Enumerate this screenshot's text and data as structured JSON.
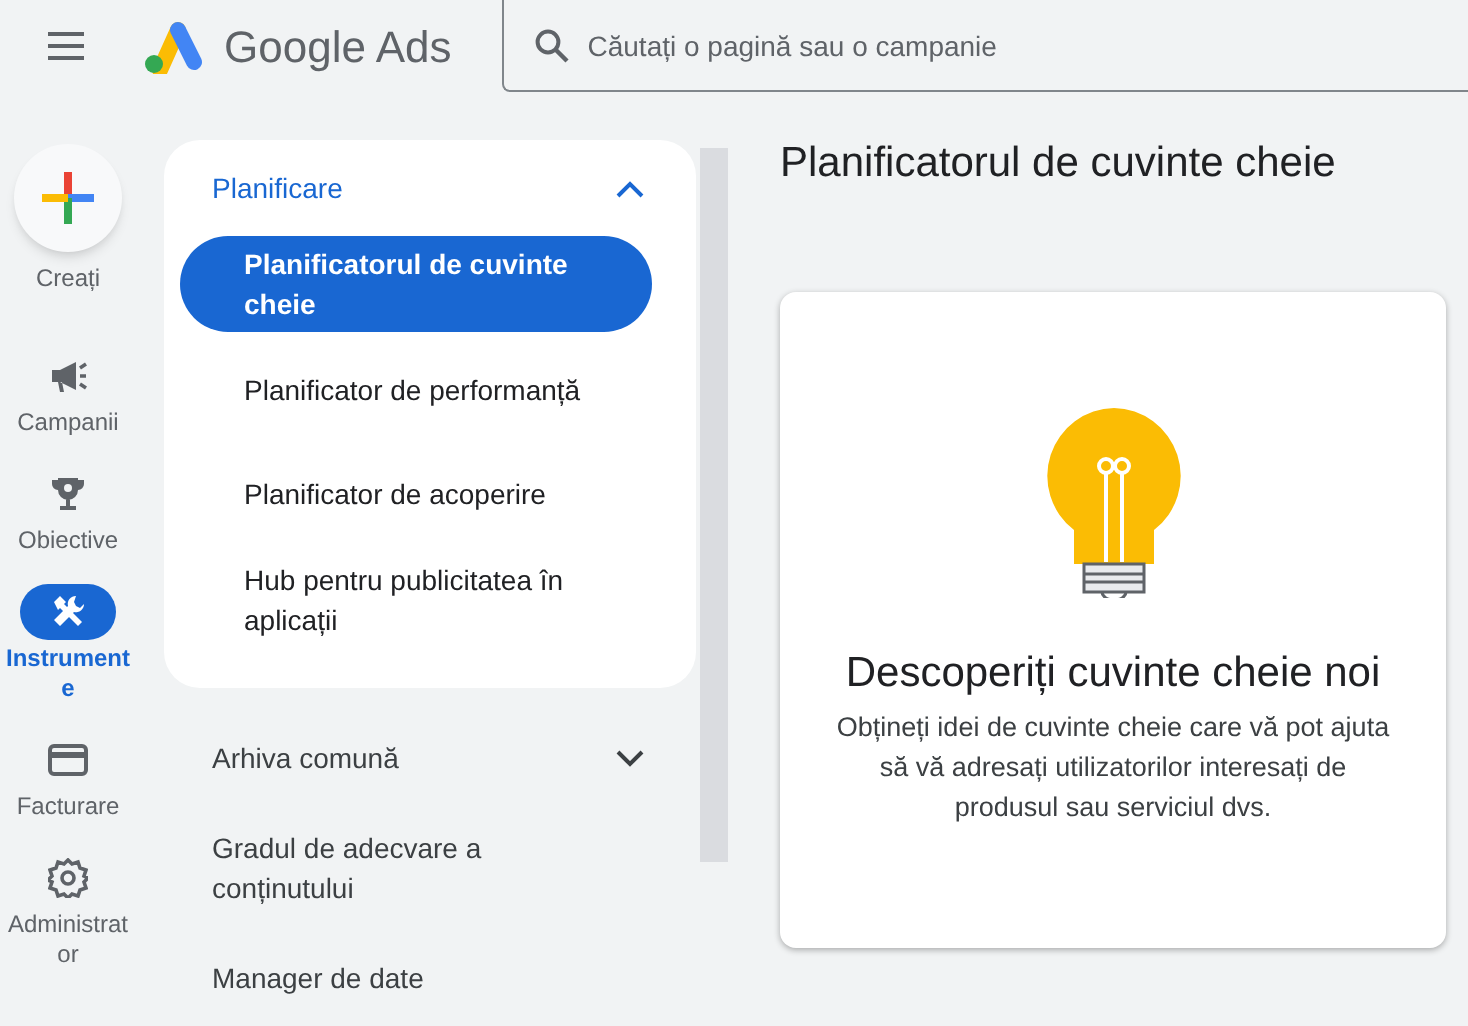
{
  "header": {
    "app_name": "Google Ads",
    "search": {
      "placeholder": "Căutați o pagină sau o campanie"
    }
  },
  "rail": {
    "create_label": "Creați",
    "items": [
      {
        "kind": "campaigns",
        "label": "Campanii",
        "selected": false
      },
      {
        "kind": "goals",
        "label": "Obiective",
        "selected": false
      },
      {
        "kind": "tools",
        "label": "Instrumente",
        "selected": true
      },
      {
        "kind": "billing",
        "label": "Facturare",
        "selected": false
      },
      {
        "kind": "admin",
        "label": "Administrator",
        "selected": false
      }
    ]
  },
  "nav": {
    "sections": [
      {
        "kind": "group",
        "label": "Planificare",
        "expanded": true,
        "children": [
          {
            "label": "Planificatorul de cuvinte cheie",
            "selected": true
          },
          {
            "label": "Planificator de performanță",
            "selected": false
          },
          {
            "label": "Planificator de acoperire",
            "selected": false
          },
          {
            "label": "Hub pentru publicitatea în aplicații",
            "selected": false
          }
        ]
      },
      {
        "kind": "group",
        "label": "Arhiva comună",
        "expanded": false
      },
      {
        "kind": "link",
        "label": "Gradul de adecvare a conținutului"
      },
      {
        "kind": "link",
        "label": "Manager de date"
      }
    ]
  },
  "main": {
    "title": "Planificatorul de cuvinte cheie",
    "card": {
      "heading": "Descoperiți cuvinte cheie noi",
      "body": "Obțineți idei de cuvinte cheie care vă pot ajuta să vă adresați utilizatorilor interesați de produsul sau serviciul dvs."
    }
  }
}
